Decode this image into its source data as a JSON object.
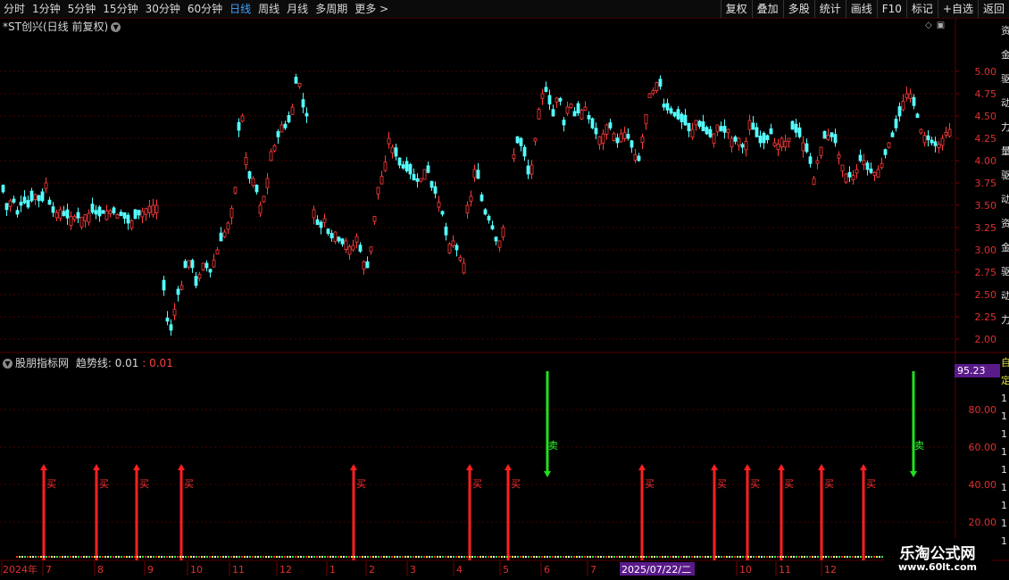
{
  "toolbar": {
    "left": [
      "分时",
      "1分钟",
      "5分钟",
      "15分钟",
      "30分钟",
      "60分钟",
      "日线",
      "周线",
      "月线",
      "多周期",
      "更多 >"
    ],
    "active": "日线",
    "right": [
      "复权",
      "叠加",
      "多股",
      "统计",
      "画线",
      "F10",
      "标记",
      "+自选",
      "返回"
    ]
  },
  "main_title": "*ST创兴(日线 前复权)",
  "sub_panel": {
    "name": "股朋指标网",
    "line_label": "趋势线: 0.01",
    "line_value": "0.01"
  },
  "price_axis": [
    "5.00",
    "4.75",
    "4.50",
    "4.25",
    "4.00",
    "3.75",
    "3.50",
    "3.25",
    "3.00",
    "2.75",
    "2.50",
    "2.25",
    "2.00"
  ],
  "indicator_axis": [
    "80.00",
    "60.00",
    "40.00",
    "20.00"
  ],
  "indicator_current": "95.23",
  "time_axis": {
    "labels": [
      "2024年",
      "7",
      "8",
      "9",
      "10",
      "11",
      "12",
      "1",
      "2",
      "3",
      "4",
      "5",
      "6",
      "7",
      "10",
      "11",
      "12"
    ],
    "cursor_date": "2025/07/22/二"
  },
  "right_strip": [
    "资",
    "金",
    "驱",
    "动",
    "力",
    "量",
    "驱",
    "动",
    "资",
    "金",
    "驱",
    "动",
    "力"
  ],
  "right_strip2": [
    "自",
    "定",
    "1",
    "1",
    "1",
    "1",
    "1",
    "1",
    "1",
    "1",
    "1"
  ],
  "signals": {
    "buy_label": "买",
    "sell_label": "卖",
    "buy_count": 13,
    "sell_count": 2
  },
  "watermark": {
    "line1": "乐淘公式网",
    "line2": "www.60lt.com"
  },
  "chart_data": {
    "type": "candlestick",
    "title": "*ST创兴(日线 前复权)",
    "ylim": [
      2.0,
      5.0
    ],
    "period": "2024年 ~ 2025年12月",
    "price_path": [
      [
        0,
        3.55
      ],
      [
        3,
        3.7
      ],
      [
        6,
        3.45
      ],
      [
        12,
        3.6
      ],
      [
        18,
        3.4
      ],
      [
        24,
        3.55
      ],
      [
        30,
        3.48
      ],
      [
        38,
        3.62
      ],
      [
        45,
        3.5
      ],
      [
        50,
        3.75
      ],
      [
        55,
        3.45
      ],
      [
        60,
        3.4
      ],
      [
        66,
        3.45
      ],
      [
        72,
        3.35
      ],
      [
        80,
        3.38
      ],
      [
        88,
        3.35
      ],
      [
        95,
        3.4
      ],
      [
        102,
        3.42
      ],
      [
        110,
        3.38
      ],
      [
        120,
        3.45
      ],
      [
        128,
        3.4
      ],
      [
        136,
        3.38
      ],
      [
        142,
        3.3
      ],
      [
        150,
        3.35
      ],
      [
        160,
        3.45
      ],
      [
        168,
        3.5
      ],
      [
        175,
        3.5
      ],
      [
        182,
        2.55
      ],
      [
        186,
        2.2
      ],
      [
        190,
        2.1
      ],
      [
        196,
        2.45
      ],
      [
        202,
        2.6
      ],
      [
        208,
        2.9
      ],
      [
        213,
        2.85
      ],
      [
        218,
        2.6
      ],
      [
        226,
        2.85
      ],
      [
        234,
        2.75
      ],
      [
        240,
        2.95
      ],
      [
        246,
        3.1
      ],
      [
        252,
        3.25
      ],
      [
        256,
        3.35
      ],
      [
        262,
        3.7
      ],
      [
        265,
        4.3
      ],
      [
        270,
        4.5
      ],
      [
        276,
        3.8
      ],
      [
        282,
        3.8
      ],
      [
        290,
        3.5
      ],
      [
        296,
        3.65
      ],
      [
        302,
        4.1
      ],
      [
        308,
        4.2
      ],
      [
        314,
        4.4
      ],
      [
        320,
        4.35
      ],
      [
        326,
        4.6
      ],
      [
        332,
        5.0
      ],
      [
        338,
        4.6
      ],
      [
        344,
        4.45
      ],
      [
        350,
        3.45
      ],
      [
        356,
        3.2
      ],
      [
        362,
        3.35
      ],
      [
        368,
        3.1
      ],
      [
        374,
        3.2
      ],
      [
        380,
        3.05
      ],
      [
        386,
        3.1
      ],
      [
        392,
        3.0
      ],
      [
        398,
        3.15
      ],
      [
        404,
        2.9
      ],
      [
        410,
        2.8
      ],
      [
        416,
        3.15
      ],
      [
        420,
        3.6
      ],
      [
        424,
        3.8
      ],
      [
        428,
        3.85
      ],
      [
        434,
        4.25
      ],
      [
        440,
        4.1
      ],
      [
        446,
        3.95
      ],
      [
        452,
        3.9
      ],
      [
        458,
        3.85
      ],
      [
        464,
        3.75
      ],
      [
        470,
        3.8
      ],
      [
        476,
        3.95
      ],
      [
        482,
        3.7
      ],
      [
        488,
        3.6
      ],
      [
        494,
        3.4
      ],
      [
        500,
        3.05
      ],
      [
        506,
        3.1
      ],
      [
        512,
        2.95
      ],
      [
        518,
        2.85
      ],
      [
        522,
        3.5
      ],
      [
        526,
        3.6
      ],
      [
        530,
        3.9
      ],
      [
        534,
        3.8
      ],
      [
        538,
        3.55
      ],
      [
        542,
        3.4
      ],
      [
        548,
        3.3
      ],
      [
        554,
        3.1
      ],
      [
        560,
        3.1
      ],
      [
        572,
        4.0
      ],
      [
        578,
        4.2
      ],
      [
        584,
        4.15
      ],
      [
        590,
        3.85
      ],
      [
        596,
        4.0
      ],
      [
        600,
        4.5
      ],
      [
        604,
        4.65
      ],
      [
        608,
        4.85
      ],
      [
        612,
        4.7
      ],
      [
        618,
        4.5
      ],
      [
        624,
        4.8
      ],
      [
        630,
        4.4
      ],
      [
        636,
        4.7
      ],
      [
        642,
        4.5
      ],
      [
        648,
        4.55
      ],
      [
        654,
        4.6
      ],
      [
        660,
        4.4
      ],
      [
        666,
        4.3
      ],
      [
        672,
        4.25
      ],
      [
        678,
        4.4
      ],
      [
        684,
        4.35
      ],
      [
        690,
        4.2
      ],
      [
        696,
        4.35
      ],
      [
        702,
        4.25
      ],
      [
        708,
        4.1
      ],
      [
        714,
        4.0
      ],
      [
        720,
        4.4
      ],
      [
        726,
        4.75
      ],
      [
        732,
        4.8
      ],
      [
        736,
        4.95
      ],
      [
        742,
        4.6
      ],
      [
        748,
        4.55
      ],
      [
        754,
        4.5
      ],
      [
        760,
        4.45
      ],
      [
        766,
        4.4
      ],
      [
        772,
        4.3
      ],
      [
        778,
        4.45
      ],
      [
        784,
        4.35
      ],
      [
        790,
        4.3
      ],
      [
        796,
        4.25
      ],
      [
        802,
        4.4
      ],
      [
        808,
        4.3
      ],
      [
        814,
        4.35
      ],
      [
        820,
        4.2
      ],
      [
        826,
        4.25
      ],
      [
        832,
        4.1
      ],
      [
        838,
        4.45
      ],
      [
        844,
        4.3
      ],
      [
        850,
        4.2
      ],
      [
        856,
        4.2
      ],
      [
        862,
        4.3
      ],
      [
        868,
        4.15
      ],
      [
        874,
        4.25
      ],
      [
        880,
        4.2
      ],
      [
        886,
        4.35
      ],
      [
        892,
        4.3
      ],
      [
        898,
        4.2
      ],
      [
        904,
        4.05
      ],
      [
        910,
        3.8
      ],
      [
        916,
        4.1
      ],
      [
        922,
        4.25
      ],
      [
        928,
        4.3
      ],
      [
        934,
        4.2
      ],
      [
        940,
        4.0
      ],
      [
        946,
        3.85
      ],
      [
        952,
        3.8
      ],
      [
        958,
        3.9
      ],
      [
        964,
        4.05
      ],
      [
        970,
        3.9
      ],
      [
        976,
        3.85
      ],
      [
        982,
        3.9
      ],
      [
        988,
        4.0
      ],
      [
        994,
        4.2
      ],
      [
        1000,
        4.3
      ],
      [
        1006,
        4.5
      ],
      [
        1012,
        4.75
      ],
      [
        1018,
        4.75
      ],
      [
        1024,
        4.55
      ],
      [
        1030,
        4.35
      ],
      [
        1036,
        4.25
      ],
      [
        1042,
        4.2
      ],
      [
        1048,
        4.15
      ],
      [
        1054,
        4.25
      ],
      [
        1060,
        4.35
      ]
    ],
    "signals": [
      {
        "type": "buy",
        "x_index": 49
      },
      {
        "type": "buy",
        "x_index": 108
      },
      {
        "type": "buy",
        "x_index": 153
      },
      {
        "type": "buy",
        "x_index": 203
      },
      {
        "type": "buy",
        "x_index": 396
      },
      {
        "type": "buy",
        "x_index": 526
      },
      {
        "type": "buy",
        "x_index": 569
      },
      {
        "type": "sell",
        "x_index": 613
      },
      {
        "type": "buy",
        "x_index": 719
      },
      {
        "type": "buy",
        "x_index": 800
      },
      {
        "type": "buy",
        "x_index": 837
      },
      {
        "type": "buy",
        "x_index": 875
      },
      {
        "type": "buy",
        "x_index": 920
      },
      {
        "type": "buy",
        "x_index": 967
      },
      {
        "type": "sell",
        "x_index": 1023
      }
    ]
  }
}
